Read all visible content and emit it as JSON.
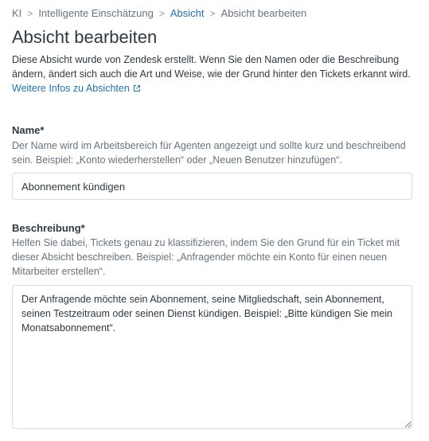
{
  "breadcrumb": {
    "items": [
      "KI",
      "Intelligente Einschätzung",
      "Absicht",
      "Absicht bearbeiten"
    ],
    "separator": ">"
  },
  "page": {
    "title": "Absicht bearbeiten",
    "intro": "Diese Absicht wurde von Zendesk erstellt. Wenn Sie den Namen oder die Beschreibung ändern, ändert sich auch die Art und Weise, wie der Grund hinter den Tickets erkannt wird.",
    "learn_more_link": "Weitere Infos zu Absichten",
    "learn_more_icon": "external-link-icon"
  },
  "name_field": {
    "label": "Name*",
    "hint": "Der Name wird im Arbeitsbereich für Agenten angezeigt und sollte kurz und beschreibend sein. Beispiel: „Konto wiederherstellen“ oder „Neuen Benutzer hinzufügen“.",
    "value": "Abonnement kündigen"
  },
  "description_field": {
    "label": "Beschreibung*",
    "hint": "Helfen Sie dabei, Tickets genau zu klassifizieren, indem Sie den Grund für ein Ticket mit dieser Absicht beschreiben. Beispiel: „Anfragender möchte ein Konto für einen neuen Mitarbeiter erstellen“.",
    "value": "Der Anfragende möchte sein Abonnement, seine Mitgliedschaft, sein Abonnement, seinen Testzeitraum oder seinen Dienst kündigen. Beispiel: „Bitte kündigen Sie mein Monatsabonnement“."
  },
  "colors": {
    "link": "#1f73b7",
    "text": "#2f3941",
    "muted": "#68737d",
    "border": "#d8dcde"
  }
}
